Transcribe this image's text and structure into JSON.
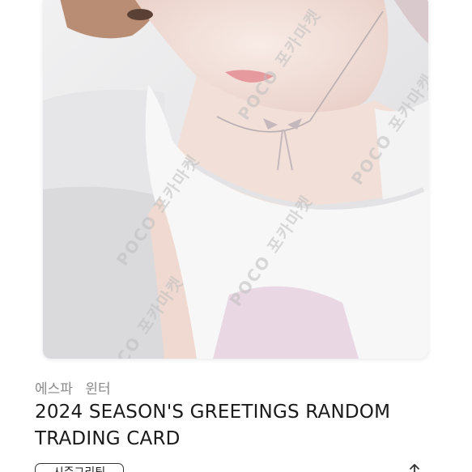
{
  "product": {
    "group": "에스파",
    "member": "윈터",
    "title_line1": "2024 SEASON'S GREETINGS RANDOM",
    "title_line2": "TRADING CARD",
    "tag_label": "시즌그리팅"
  },
  "card": {
    "watermark_text": "POCO 포카마켓",
    "image_subject": "photocard",
    "background_color": "#ececee"
  },
  "icons": {
    "share": "share-icon"
  }
}
